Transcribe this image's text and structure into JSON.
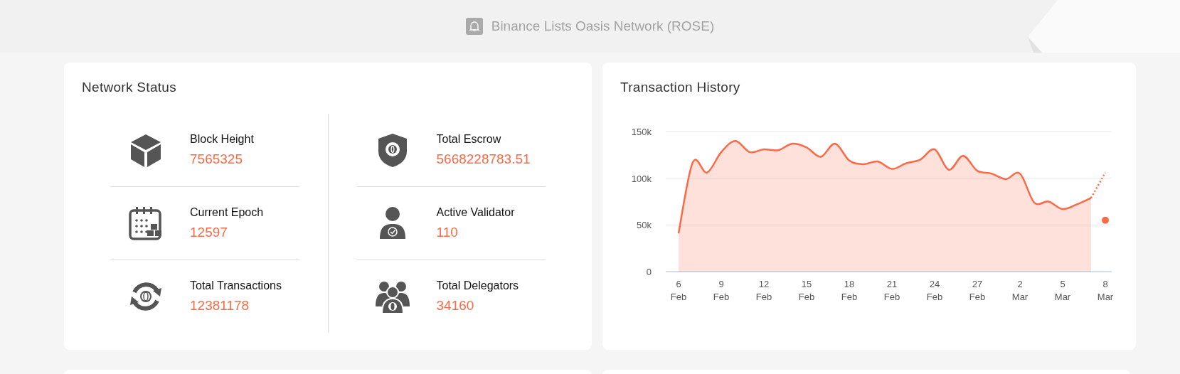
{
  "announcement": {
    "text": "Binance Lists Oasis Network (ROSE)"
  },
  "network_status": {
    "title": "Network Status",
    "columns": [
      [
        {
          "label": "Block Height",
          "value": "7565325"
        },
        {
          "label": "Current Epoch",
          "value": "12597"
        },
        {
          "label": "Total Transactions",
          "value": "12381178"
        }
      ],
      [
        {
          "label": "Total Escrow",
          "value": "5668228783.51"
        },
        {
          "label": "Active Validator",
          "value": "110"
        },
        {
          "label": "Total Delegators",
          "value": "34160"
        }
      ]
    ]
  },
  "transaction_history": {
    "title": "Transaction History",
    "chart_data": {
      "type": "area",
      "categories": [
        "6 Feb",
        null,
        null,
        "9 Feb",
        null,
        null,
        "12 Feb",
        null,
        null,
        "15 Feb",
        null,
        null,
        "18 Feb",
        null,
        null,
        "21 Feb",
        null,
        null,
        "24 Feb",
        null,
        null,
        "27 Feb",
        null,
        null,
        "2 Mar",
        null,
        null,
        "5 Mar",
        null,
        null,
        "8 Mar"
      ],
      "yticks": [
        {
          "value": 0,
          "label": "0"
        },
        {
          "value": 50000,
          "label": "50k"
        },
        {
          "value": 100000,
          "label": "100k"
        },
        {
          "value": 150000,
          "label": "150k"
        }
      ],
      "ylim": [
        0,
        150000
      ],
      "series": [
        {
          "color": "#fa6a46",
          "values": [
            41000,
            117000,
            106000,
            128000,
            140000,
            128000,
            131000,
            130000,
            137000,
            133000,
            123000,
            137000,
            119000,
            115000,
            118000,
            110000,
            116000,
            120000,
            131000,
            109000,
            124000,
            108000,
            105000,
            99000,
            105000,
            74000,
            75000,
            67000,
            72000,
            79000,
            null
          ]
        },
        {
          "type": "line",
          "line_style": "dotted",
          "color": "#fa6a46",
          "values": [
            null,
            null,
            null,
            null,
            null,
            null,
            null,
            null,
            null,
            null,
            null,
            null,
            null,
            null,
            null,
            null,
            null,
            null,
            null,
            null,
            null,
            null,
            null,
            null,
            null,
            null,
            null,
            null,
            null,
            79000,
            106000
          ]
        },
        {
          "type": "scatter",
          "color": "#fa6a46",
          "values": [
            null,
            null,
            null,
            null,
            null,
            null,
            null,
            null,
            null,
            null,
            null,
            null,
            null,
            null,
            null,
            null,
            null,
            null,
            null,
            null,
            null,
            null,
            null,
            null,
            null,
            null,
            null,
            null,
            null,
            null,
            55000
          ]
        }
      ]
    }
  }
}
